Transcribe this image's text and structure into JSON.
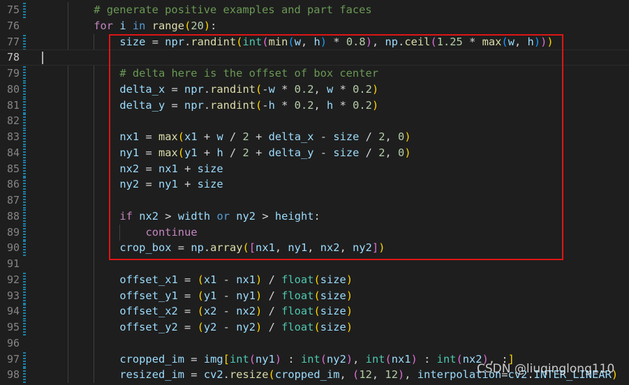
{
  "colors": {
    "background": "#1e1e1e",
    "line_number": "#858585",
    "comment": "#6a9955",
    "keyword": "#c586c0",
    "function": "#dcdcaa",
    "variable": "#9cdcfe",
    "number": "#b5cea8",
    "highlight_box": "#e01515",
    "gutter_modified": "#1b81a8"
  },
  "editor": {
    "current_line": 78,
    "lines": [
      {
        "n": "75",
        "indent": 2,
        "mod": true,
        "tokens": [
          [
            "c",
            "# generate positive examples and part faces"
          ]
        ]
      },
      {
        "n": "76",
        "indent": 2,
        "mod": false,
        "tokens": [
          [
            "k",
            "for"
          ],
          [
            "o",
            " "
          ],
          [
            "v",
            "i"
          ],
          [
            "o",
            " "
          ],
          [
            "k2",
            "in"
          ],
          [
            "o",
            " "
          ],
          [
            "f",
            "range"
          ],
          [
            "p1",
            "("
          ],
          [
            "n",
            "20"
          ],
          [
            "p1",
            ")"
          ],
          [
            "o",
            ":"
          ]
        ]
      },
      {
        "n": "77",
        "indent": 3,
        "mod": true,
        "tokens": [
          [
            "v",
            "size"
          ],
          [
            "o",
            " = "
          ],
          [
            "v",
            "npr"
          ],
          [
            "o",
            "."
          ],
          [
            "f",
            "randint"
          ],
          [
            "p1",
            "("
          ],
          [
            "b",
            "int"
          ],
          [
            "p2",
            "("
          ],
          [
            "f",
            "min"
          ],
          [
            "p3",
            "("
          ],
          [
            "v",
            "w"
          ],
          [
            "o",
            ", "
          ],
          [
            "v",
            "h"
          ],
          [
            "p3",
            ")"
          ],
          [
            "o",
            " * "
          ],
          [
            "n",
            "0.8"
          ],
          [
            "p2",
            ")"
          ],
          [
            "o",
            ", "
          ],
          [
            "v",
            "np"
          ],
          [
            "o",
            "."
          ],
          [
            "f",
            "ceil"
          ],
          [
            "p2",
            "("
          ],
          [
            "n",
            "1.25"
          ],
          [
            "o",
            " * "
          ],
          [
            "f",
            "max"
          ],
          [
            "p3",
            "("
          ],
          [
            "v",
            "w"
          ],
          [
            "o",
            ", "
          ],
          [
            "v",
            "h"
          ],
          [
            "p3",
            ")"
          ],
          [
            "p2",
            ")"
          ],
          [
            "p1",
            ")"
          ]
        ]
      },
      {
        "n": "78",
        "indent": 0,
        "mod": false,
        "tokens": []
      },
      {
        "n": "79",
        "indent": 3,
        "mod": true,
        "tokens": [
          [
            "c",
            "# delta here is the offset of box center"
          ]
        ]
      },
      {
        "n": "80",
        "indent": 3,
        "mod": true,
        "tokens": [
          [
            "v",
            "delta_x"
          ],
          [
            "o",
            " = "
          ],
          [
            "v",
            "npr"
          ],
          [
            "o",
            "."
          ],
          [
            "f",
            "randint"
          ],
          [
            "p1",
            "("
          ],
          [
            "o",
            "-"
          ],
          [
            "v",
            "w"
          ],
          [
            "o",
            " * "
          ],
          [
            "n",
            "0.2"
          ],
          [
            "o",
            ", "
          ],
          [
            "v",
            "w"
          ],
          [
            "o",
            " * "
          ],
          [
            "n",
            "0.2"
          ],
          [
            "p1",
            ")"
          ]
        ]
      },
      {
        "n": "81",
        "indent": 3,
        "mod": true,
        "tokens": [
          [
            "v",
            "delta_y"
          ],
          [
            "o",
            " = "
          ],
          [
            "v",
            "npr"
          ],
          [
            "o",
            "."
          ],
          [
            "f",
            "randint"
          ],
          [
            "p1",
            "("
          ],
          [
            "o",
            "-"
          ],
          [
            "v",
            "h"
          ],
          [
            "o",
            " * "
          ],
          [
            "n",
            "0.2"
          ],
          [
            "o",
            ", "
          ],
          [
            "v",
            "h"
          ],
          [
            "o",
            " * "
          ],
          [
            "n",
            "0.2"
          ],
          [
            "p1",
            ")"
          ]
        ]
      },
      {
        "n": "82",
        "indent": 3,
        "mod": true,
        "tokens": []
      },
      {
        "n": "83",
        "indent": 3,
        "mod": true,
        "tokens": [
          [
            "v",
            "nx1"
          ],
          [
            "o",
            " = "
          ],
          [
            "f",
            "max"
          ],
          [
            "p1",
            "("
          ],
          [
            "v",
            "x1"
          ],
          [
            "o",
            " + "
          ],
          [
            "v",
            "w"
          ],
          [
            "o",
            " / "
          ],
          [
            "n",
            "2"
          ],
          [
            "o",
            " + "
          ],
          [
            "v",
            "delta_x"
          ],
          [
            "o",
            " - "
          ],
          [
            "v",
            "size"
          ],
          [
            "o",
            " / "
          ],
          [
            "n",
            "2"
          ],
          [
            "o",
            ", "
          ],
          [
            "n",
            "0"
          ],
          [
            "p1",
            ")"
          ]
        ]
      },
      {
        "n": "84",
        "indent": 3,
        "mod": true,
        "tokens": [
          [
            "v",
            "ny1"
          ],
          [
            "o",
            " = "
          ],
          [
            "f",
            "max"
          ],
          [
            "p1",
            "("
          ],
          [
            "v",
            "y1"
          ],
          [
            "o",
            " + "
          ],
          [
            "v",
            "h"
          ],
          [
            "o",
            " / "
          ],
          [
            "n",
            "2"
          ],
          [
            "o",
            " + "
          ],
          [
            "v",
            "delta_y"
          ],
          [
            "o",
            " - "
          ],
          [
            "v",
            "size"
          ],
          [
            "o",
            " / "
          ],
          [
            "n",
            "2"
          ],
          [
            "o",
            ", "
          ],
          [
            "n",
            "0"
          ],
          [
            "p1",
            ")"
          ]
        ]
      },
      {
        "n": "85",
        "indent": 3,
        "mod": true,
        "tokens": [
          [
            "v",
            "nx2"
          ],
          [
            "o",
            " = "
          ],
          [
            "v",
            "nx1"
          ],
          [
            "o",
            " + "
          ],
          [
            "v",
            "size"
          ]
        ]
      },
      {
        "n": "86",
        "indent": 3,
        "mod": true,
        "tokens": [
          [
            "v",
            "ny2"
          ],
          [
            "o",
            " = "
          ],
          [
            "v",
            "ny1"
          ],
          [
            "o",
            " + "
          ],
          [
            "v",
            "size"
          ]
        ]
      },
      {
        "n": "87",
        "indent": 3,
        "mod": true,
        "tokens": []
      },
      {
        "n": "88",
        "indent": 3,
        "mod": true,
        "tokens": [
          [
            "k",
            "if"
          ],
          [
            "o",
            " "
          ],
          [
            "v",
            "nx2"
          ],
          [
            "o",
            " > "
          ],
          [
            "v",
            "width"
          ],
          [
            "o",
            " "
          ],
          [
            "k2",
            "or"
          ],
          [
            "o",
            " "
          ],
          [
            "v",
            "ny2"
          ],
          [
            "o",
            " > "
          ],
          [
            "v",
            "height"
          ],
          [
            "o",
            ":"
          ]
        ]
      },
      {
        "n": "89",
        "indent": 4,
        "mod": true,
        "tokens": [
          [
            "k",
            "continue"
          ]
        ]
      },
      {
        "n": "90",
        "indent": 3,
        "mod": true,
        "tokens": [
          [
            "v",
            "crop_box"
          ],
          [
            "o",
            " = "
          ],
          [
            "v",
            "np"
          ],
          [
            "o",
            "."
          ],
          [
            "f",
            "array"
          ],
          [
            "p1",
            "("
          ],
          [
            "p2",
            "["
          ],
          [
            "v",
            "nx1"
          ],
          [
            "o",
            ", "
          ],
          [
            "v",
            "ny1"
          ],
          [
            "o",
            ", "
          ],
          [
            "v",
            "nx2"
          ],
          [
            "o",
            ", "
          ],
          [
            "v",
            "ny2"
          ],
          [
            "p2",
            "]"
          ],
          [
            "p1",
            ")"
          ]
        ]
      },
      {
        "n": "91",
        "indent": 3,
        "mod": false,
        "tokens": []
      },
      {
        "n": "92",
        "indent": 3,
        "mod": true,
        "tokens": [
          [
            "v",
            "offset_x1"
          ],
          [
            "o",
            " = "
          ],
          [
            "p1",
            "("
          ],
          [
            "v",
            "x1"
          ],
          [
            "o",
            " - "
          ],
          [
            "v",
            "nx1"
          ],
          [
            "p1",
            ")"
          ],
          [
            "o",
            " / "
          ],
          [
            "b",
            "float"
          ],
          [
            "p1",
            "("
          ],
          [
            "v",
            "size"
          ],
          [
            "p1",
            ")"
          ]
        ]
      },
      {
        "n": "93",
        "indent": 3,
        "mod": true,
        "tokens": [
          [
            "v",
            "offset_y1"
          ],
          [
            "o",
            " = "
          ],
          [
            "p1",
            "("
          ],
          [
            "v",
            "y1"
          ],
          [
            "o",
            " - "
          ],
          [
            "v",
            "ny1"
          ],
          [
            "p1",
            ")"
          ],
          [
            "o",
            " / "
          ],
          [
            "b",
            "float"
          ],
          [
            "p1",
            "("
          ],
          [
            "v",
            "size"
          ],
          [
            "p1",
            ")"
          ]
        ]
      },
      {
        "n": "94",
        "indent": 3,
        "mod": true,
        "tokens": [
          [
            "v",
            "offset_x2"
          ],
          [
            "o",
            " = "
          ],
          [
            "p1",
            "("
          ],
          [
            "v",
            "x2"
          ],
          [
            "o",
            " - "
          ],
          [
            "v",
            "nx2"
          ],
          [
            "p1",
            ")"
          ],
          [
            "o",
            " / "
          ],
          [
            "b",
            "float"
          ],
          [
            "p1",
            "("
          ],
          [
            "v",
            "size"
          ],
          [
            "p1",
            ")"
          ]
        ]
      },
      {
        "n": "95",
        "indent": 3,
        "mod": true,
        "tokens": [
          [
            "v",
            "offset_y2"
          ],
          [
            "o",
            " = "
          ],
          [
            "p1",
            "("
          ],
          [
            "v",
            "y2"
          ],
          [
            "o",
            " - "
          ],
          [
            "v",
            "ny2"
          ],
          [
            "p1",
            ")"
          ],
          [
            "o",
            " / "
          ],
          [
            "b",
            "float"
          ],
          [
            "p1",
            "("
          ],
          [
            "v",
            "size"
          ],
          [
            "p1",
            ")"
          ]
        ]
      },
      {
        "n": "96",
        "indent": 3,
        "mod": false,
        "tokens": []
      },
      {
        "n": "97",
        "indent": 3,
        "mod": true,
        "tokens": [
          [
            "v",
            "cropped_im"
          ],
          [
            "o",
            " = "
          ],
          [
            "v",
            "img"
          ],
          [
            "p1",
            "["
          ],
          [
            "b",
            "int"
          ],
          [
            "p2",
            "("
          ],
          [
            "v",
            "ny1"
          ],
          [
            "p2",
            ")"
          ],
          [
            "o",
            " : "
          ],
          [
            "b",
            "int"
          ],
          [
            "p2",
            "("
          ],
          [
            "v",
            "ny2"
          ],
          [
            "p2",
            ")"
          ],
          [
            "o",
            ", "
          ],
          [
            "b",
            "int"
          ],
          [
            "p2",
            "("
          ],
          [
            "v",
            "nx1"
          ],
          [
            "p2",
            ")"
          ],
          [
            "o",
            " : "
          ],
          [
            "b",
            "int"
          ],
          [
            "p2",
            "("
          ],
          [
            "v",
            "nx2"
          ],
          [
            "p2",
            ")"
          ],
          [
            "o",
            ", :"
          ],
          [
            "p1",
            "]"
          ]
        ]
      },
      {
        "n": "98",
        "indent": 3,
        "mod": true,
        "tokens": [
          [
            "v",
            "resized_im"
          ],
          [
            "o",
            " = "
          ],
          [
            "v",
            "cv2"
          ],
          [
            "o",
            "."
          ],
          [
            "f",
            "resize"
          ],
          [
            "p1",
            "("
          ],
          [
            "v",
            "cropped_im"
          ],
          [
            "o",
            ", "
          ],
          [
            "p2",
            "("
          ],
          [
            "n",
            "12"
          ],
          [
            "o",
            ", "
          ],
          [
            "n",
            "12"
          ],
          [
            "p2",
            ")"
          ],
          [
            "o",
            ", "
          ],
          [
            "v",
            "interpolation"
          ],
          [
            "o",
            "="
          ],
          [
            "v",
            "cv2"
          ],
          [
            "o",
            "."
          ],
          [
            "v",
            "INTER_LINEAR"
          ],
          [
            "p1",
            ")"
          ]
        ]
      }
    ]
  },
  "watermark": "CSDN @liuqinglong110"
}
